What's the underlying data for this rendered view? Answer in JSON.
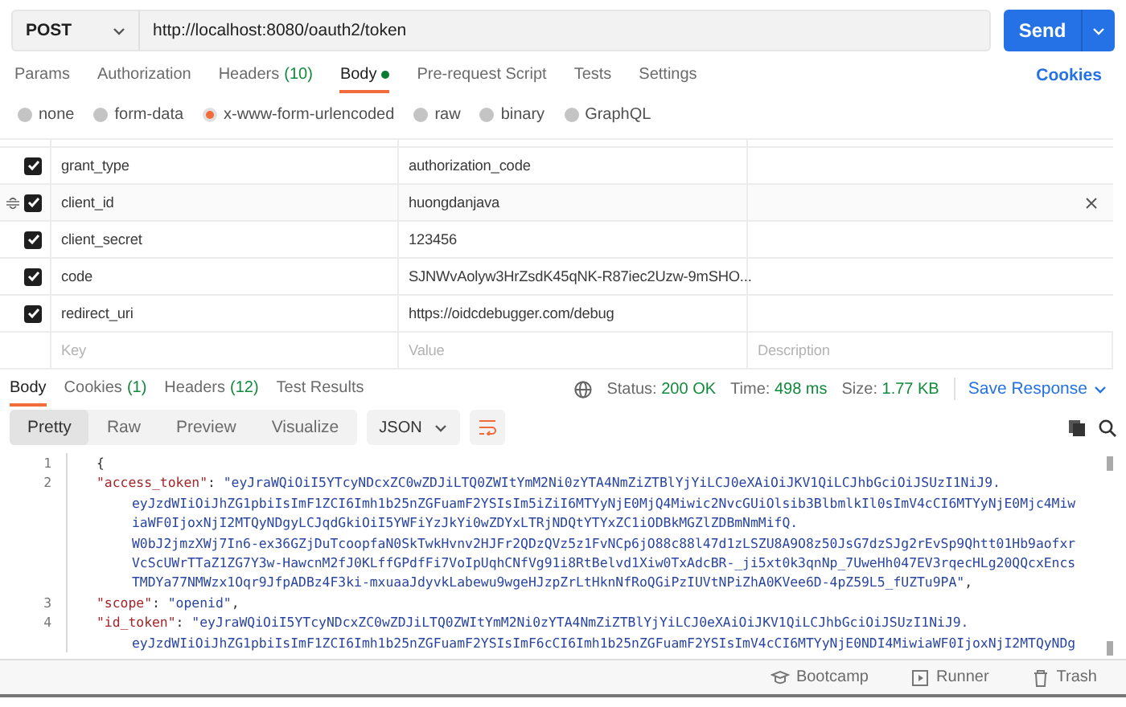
{
  "request": {
    "method": "POST",
    "url": "http://localhost:8080/oauth2/token",
    "send": "Send"
  },
  "tabs": [
    {
      "label": "Params",
      "selected": false
    },
    {
      "label": "Authorization",
      "selected": false
    },
    {
      "label": "Headers",
      "count": "(10)",
      "selected": false
    },
    {
      "label": "Body",
      "dot": true,
      "selected": true
    },
    {
      "label": "Pre-request Script",
      "selected": false
    },
    {
      "label": "Tests",
      "selected": false
    },
    {
      "label": "Settings",
      "selected": false
    }
  ],
  "cookies_link": "Cookies",
  "body_types": [
    {
      "label": "none",
      "selected": false
    },
    {
      "label": "form-data",
      "selected": false
    },
    {
      "label": "x-www-form-urlencoded",
      "selected": true
    },
    {
      "label": "raw",
      "selected": false
    },
    {
      "label": "binary",
      "selected": false
    },
    {
      "label": "GraphQL",
      "selected": false
    }
  ],
  "params": [
    {
      "key": "grant_type",
      "value": "authorization_code",
      "checked": true,
      "hovered": false
    },
    {
      "key": "client_id",
      "value": "huongdanjava",
      "checked": true,
      "hovered": true
    },
    {
      "key": "client_secret",
      "value": "123456",
      "checked": true,
      "hovered": false
    },
    {
      "key": "code",
      "value": "SJNWvAolyw3HrZsdK45qNK-R87iec2Uzw-9mSHO...",
      "checked": true,
      "hovered": false
    },
    {
      "key": "redirect_uri",
      "value": "https://oidcdebugger.com/debug",
      "checked": true,
      "hovered": false
    }
  ],
  "new_param": {
    "key_placeholder": "Key",
    "value_placeholder": "Value",
    "description_placeholder": "Description"
  },
  "response_tabs": [
    {
      "label": "Body",
      "selected": true
    },
    {
      "label": "Cookies",
      "count": "(1)",
      "selected": false
    },
    {
      "label": "Headers",
      "count": "(12)",
      "selected": false
    },
    {
      "label": "Test Results",
      "selected": false
    }
  ],
  "status": [
    {
      "label": "Status:",
      "value": "200 OK"
    },
    {
      "label": "Time:",
      "value": "498 ms"
    },
    {
      "label": "Size:",
      "value": "1.77 KB"
    }
  ],
  "save_response": "Save Response",
  "view_modes": [
    {
      "label": "Pretty",
      "selected": true
    },
    {
      "label": "Raw",
      "selected": false
    },
    {
      "label": "Preview",
      "selected": false
    },
    {
      "label": "Visualize",
      "selected": false
    }
  ],
  "format": "JSON",
  "code_lines": [
    {
      "number": "1",
      "parts": [
        {
          "kind": "punct",
          "text": "{"
        }
      ]
    },
    {
      "number": "2",
      "parts": [
        {
          "kind": "key",
          "text": "\"access_token\""
        },
        {
          "kind": "punct",
          "text": ": "
        },
        {
          "kind": "string",
          "text": "\"eyJraWQiOiI5YTcyNDcxZC0wZDJiLTQ0ZWItYmM2Ni0zYTA4NmZiZTBlYjYiLCJ0eXAiOiJKV1QiLCJhbGciOiJSUzI1NiJ9."
        }
      ]
    },
    {
      "parts": [
        {
          "kind": "string",
          "text": "eyJzdWIiOiJhZG1pbiIsImF1ZCI6Imh1b25nZGFuamF2YSIsIm5iZiI6MTYyNjE0MjQ4Miwic2NvcGUiOlsib3BlbmlkIl0sImV4cCI6MTYyNjE0Mjc4Miw"
        }
      ]
    },
    {
      "parts": [
        {
          "kind": "string",
          "text": "iaWF0IjoxNjI2MTQyNDgyLCJqdGkiOiI5YWFiYzJkYi0wZDYxLTRjNDQtYTYxZC1iODBkMGZlZDBmNmMifQ."
        }
      ]
    },
    {
      "parts": [
        {
          "kind": "string",
          "text": "W0bJ2jmzXWj7In6-ex36GZjDuTcoopfaN0SkTwkHvnv2HJFr2QDzQVz5z1FvNCp6jO88c88l47d1zLSZU8A9O8z50JsG7dzSJg2rEvSp9Qhtt01Hb9aofxr"
        }
      ]
    },
    {
      "parts": [
        {
          "kind": "string",
          "text": "VcScUWrTTaZ1ZG7Y3w-HawcnM2fJ0KLffGPdfFi7VoIpUqhCNfVg91i8RtBelvd1Xiw0TxAdcBR-_ji5xt0k3qnNp_7UweHh047EV3rqecHLg20QQcxEncs"
        }
      ]
    },
    {
      "parts": [
        {
          "kind": "string",
          "text": "TMDYa77NMWzx1Oqr9JfpADBz4F3ki-mxuaaJdyvkLabewu9wgeHJzpZrLtHknNfRoQGiPzIUVtNPiZhA0KVee6D-4pZ59L5_fUZTu9PA\""
        },
        {
          "kind": "punct",
          "text": ","
        }
      ]
    },
    {
      "number": "3",
      "parts": [
        {
          "kind": "key",
          "text": "\"scope\""
        },
        {
          "kind": "punct",
          "text": ": "
        },
        {
          "kind": "string",
          "text": "\"openid\""
        },
        {
          "kind": "punct",
          "text": ","
        }
      ]
    },
    {
      "number": "4",
      "parts": [
        {
          "kind": "key",
          "text": "\"id_token\""
        },
        {
          "kind": "punct",
          "text": ": "
        },
        {
          "kind": "string",
          "text": "\"eyJraWQiOiI5YTcyNDcxZC0wZDJiLTQ0ZWItYmM2Ni0zYTA4NmZiZTBlYjYiLCJ0eXAiOiJKV1QiLCJhbGciOiJSUzI1NiJ9."
        }
      ]
    },
    {
      "parts": [
        {
          "kind": "string",
          "text": "eyJzdWIiOiJhZG1pbiIsImF1ZCI6Imh1b25nZGFuamF2YSIsImF6cCI6Imh1b25nZGFuamF2YSIsImV4cCI6MTYyNjE0NDI4MiwiaWF0IjoxNjI2MTQyNDg"
        }
      ]
    }
  ],
  "footer": [
    "Bootcamp",
    "Runner",
    "Trash"
  ]
}
